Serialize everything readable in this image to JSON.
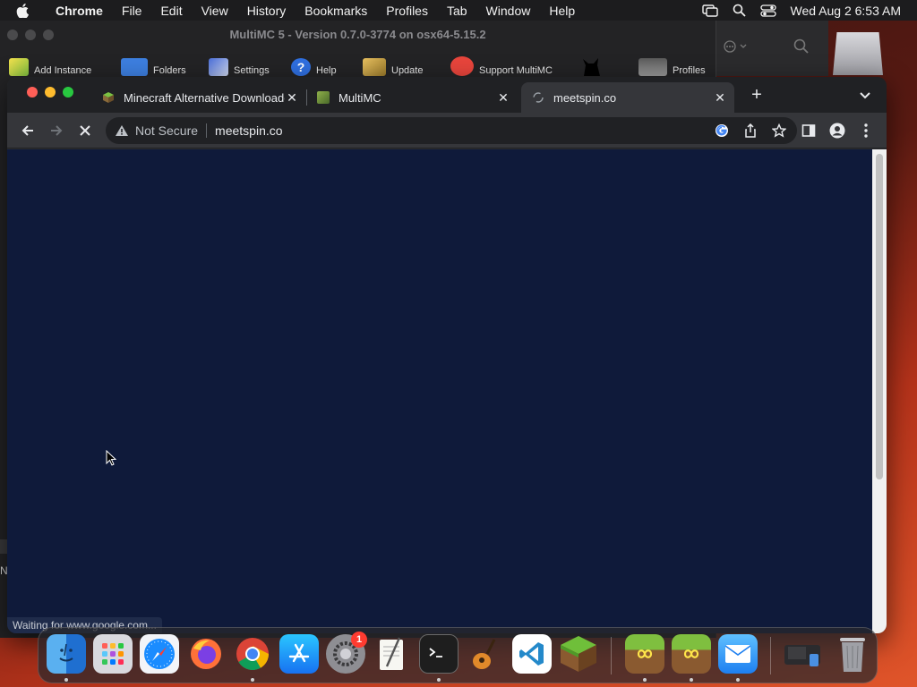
{
  "menubar": {
    "app_name": "Chrome",
    "items": [
      "File",
      "Edit",
      "View",
      "History",
      "Bookmarks",
      "Profiles",
      "Tab",
      "Window",
      "Help"
    ],
    "clock": "Wed Aug 2  6:53 AM"
  },
  "multimc": {
    "title": "MultiMC 5 - Version 0.7.0-3774 on osx64-5.15.2",
    "toolbar": {
      "add_instance": "Add Instance",
      "folders": "Folders",
      "settings": "Settings",
      "help": "Help",
      "update": "Update",
      "support": "Support MultiMC",
      "profiles": "Profiles"
    },
    "side_letter": "N"
  },
  "chrome": {
    "tabs": [
      {
        "label": "Minecraft Alternative Downloader",
        "active": false
      },
      {
        "label": "MultiMC",
        "active": false
      },
      {
        "label": "meetspin.co",
        "active": true
      }
    ],
    "security_label": "Not Secure",
    "url": "meetspin.co",
    "status_text": "Waiting for www.google.com...",
    "page_background": "#0f1a3a"
  },
  "dock": {
    "apps": [
      "finder-icon",
      "launchpad-icon",
      "safari-icon",
      "firefox-icon",
      "chrome-icon",
      "app-store-icon",
      "system-settings-icon",
      "textedit-icon",
      "terminal-icon",
      "garageband-icon",
      "vscode-icon",
      "minecraft-icon",
      "multimc-icon",
      "multimc-2-icon",
      "mail-icon",
      "downloads-icon",
      "trash-icon"
    ],
    "settings_badge": "1"
  }
}
